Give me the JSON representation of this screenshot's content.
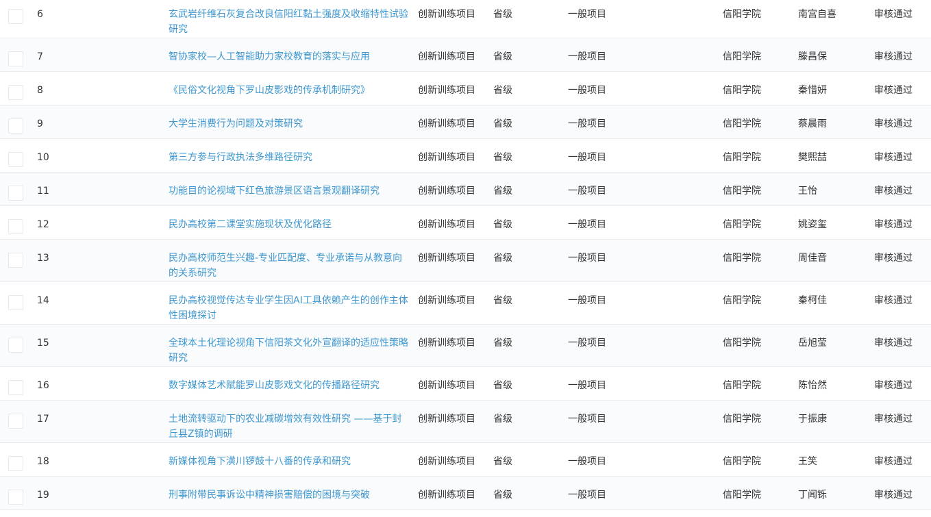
{
  "rows": [
    {
      "num": "6",
      "name": "玄武岩纤维石灰复合改良信阳红黏土强度及收缩特性试验研究",
      "type": "创新训练项目",
      "level": "省级",
      "category": "一般项目",
      "school": "信阳学院",
      "leader": "南宫自喜",
      "status": "审核通过"
    },
    {
      "num": "7",
      "name": "智协家校—人工智能助力家校教育的落实与应用",
      "type": "创新训练项目",
      "level": "省级",
      "category": "一般项目",
      "school": "信阳学院",
      "leader": "滕昌保",
      "status": "审核通过"
    },
    {
      "num": "8",
      "name": "《民俗文化视角下罗山皮影戏的传承机制研究》",
      "type": "创新训练项目",
      "level": "省级",
      "category": "一般项目",
      "school": "信阳学院",
      "leader": "秦惜妍",
      "status": "审核通过"
    },
    {
      "num": "9",
      "name": "大学生消费行为问题及对策研究",
      "type": "创新训练项目",
      "level": "省级",
      "category": "一般项目",
      "school": "信阳学院",
      "leader": "蔡晨雨",
      "status": "审核通过"
    },
    {
      "num": "10",
      "name": "第三方参与行政执法多维路径研究",
      "type": "创新训练项目",
      "level": "省级",
      "category": "一般项目",
      "school": "信阳学院",
      "leader": "樊熙喆",
      "status": "审核通过"
    },
    {
      "num": "11",
      "name": "功能目的论视域下红色旅游景区语言景观翻译研究",
      "type": "创新训练项目",
      "level": "省级",
      "category": "一般项目",
      "school": "信阳学院",
      "leader": "王怡",
      "status": "审核通过"
    },
    {
      "num": "12",
      "name": "民办高校第二课堂实施现状及优化路径",
      "type": "创新训练项目",
      "level": "省级",
      "category": "一般项目",
      "school": "信阳学院",
      "leader": "姚姿玺",
      "status": "审核通过"
    },
    {
      "num": "13",
      "name": "民办高校师范生兴趣-专业匹配度、专业承诺与从教意向的关系研究",
      "type": "创新训练项目",
      "level": "省级",
      "category": "一般项目",
      "school": "信阳学院",
      "leader": "周佳音",
      "status": "审核通过"
    },
    {
      "num": "14",
      "name": "民办高校视觉传达专业学生因AI工具依赖产生的创作主体性困境探讨",
      "type": "创新训练项目",
      "level": "省级",
      "category": "一般项目",
      "school": "信阳学院",
      "leader": "秦柯佳",
      "status": "审核通过"
    },
    {
      "num": "15",
      "name": "全球本土化理论视角下信阳茶文化外宣翻译的适应性策略研究",
      "type": "创新训练项目",
      "level": "省级",
      "category": "一般项目",
      "school": "信阳学院",
      "leader": "岳旭莹",
      "status": "审核通过"
    },
    {
      "num": "16",
      "name": "数字媒体艺术赋能罗山皮影戏文化的传播路径研究",
      "type": "创新训练项目",
      "level": "省级",
      "category": "一般项目",
      "school": "信阳学院",
      "leader": "陈怡然",
      "status": "审核通过"
    },
    {
      "num": "17",
      "name": "土地流转驱动下的农业减碳增效有效性研究 ——基于封丘县Z镇的调研",
      "type": "创新训练项目",
      "level": "省级",
      "category": "一般项目",
      "school": "信阳学院",
      "leader": "于振康",
      "status": "审核通过"
    },
    {
      "num": "18",
      "name": "新媒体视角下潢川锣鼓十八番的传承和研究",
      "type": "创新训练项目",
      "level": "省级",
      "category": "一般项目",
      "school": "信阳学院",
      "leader": "王笑",
      "status": "审核通过"
    },
    {
      "num": "19",
      "name": "刑事附带民事诉讼中精神损害赔偿的困境与突破",
      "type": "创新训练项目",
      "level": "省级",
      "category": "一般项目",
      "school": "信阳学院",
      "leader": "丁闻铄",
      "status": "审核通过"
    }
  ]
}
